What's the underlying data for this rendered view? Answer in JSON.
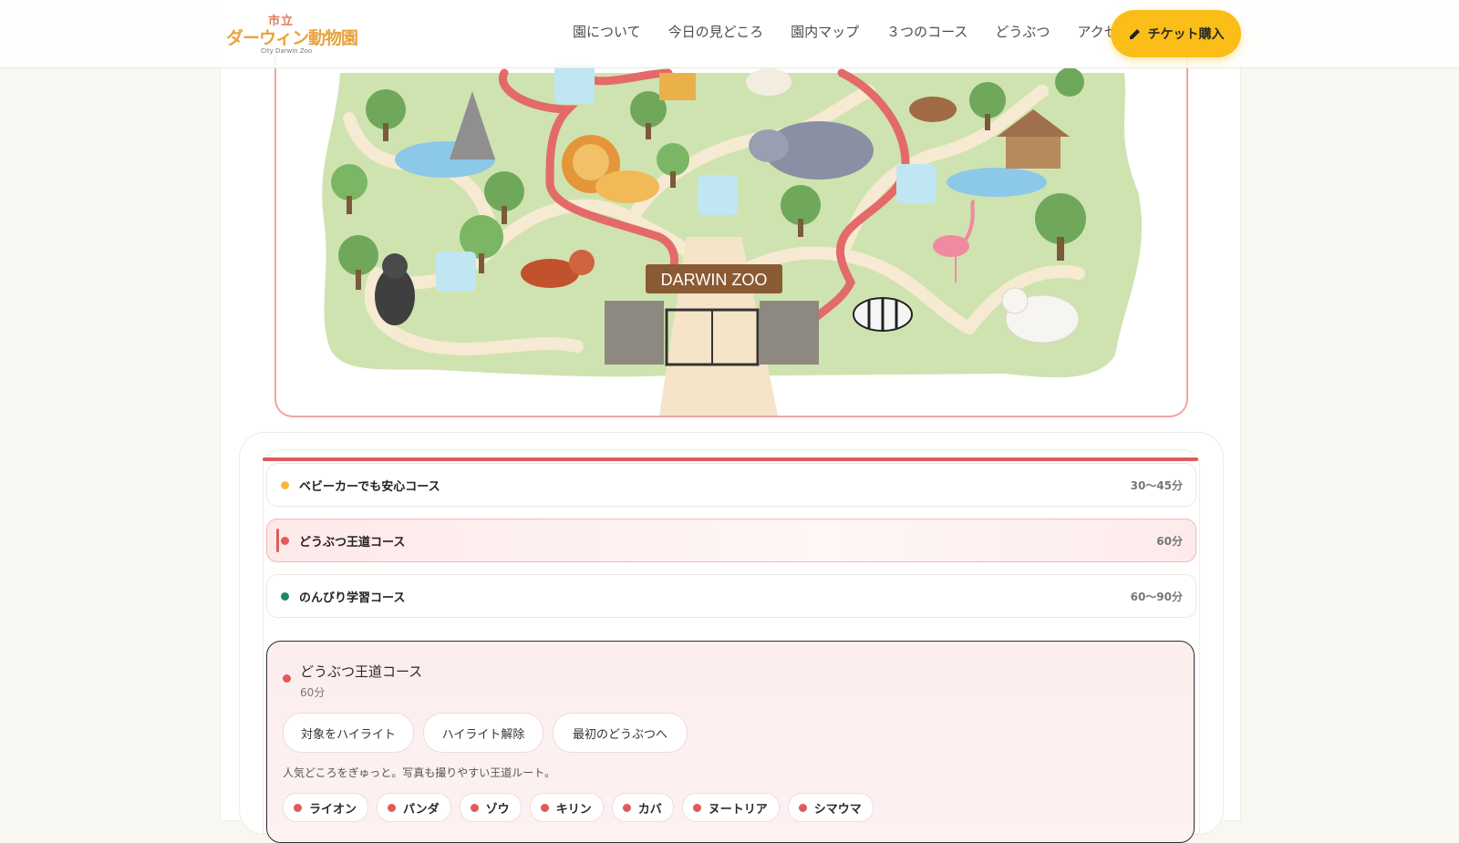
{
  "header": {
    "logo": {
      "top": "市立",
      "main": "ダーウィン動物園",
      "sub": "City Darwin Zoo"
    },
    "nav": [
      "園について",
      "今日の見どころ",
      "園内マップ",
      "３つのコース",
      "どうぶつ",
      "アクセス"
    ],
    "ticket_label": "チケット購入"
  },
  "map": {
    "sign": "DARWIN ZOO"
  },
  "courses": [
    {
      "name": "ベビーカーでも安心コース",
      "time": "30〜45分",
      "color": "#f6b93b",
      "active": false
    },
    {
      "name": "どうぶつ王道コース",
      "time": "60分",
      "color": "#e05a5a",
      "active": true
    },
    {
      "name": "のんびり学習コース",
      "time": "60〜90分",
      "color": "#1e8a5e",
      "active": false
    }
  ],
  "detail": {
    "title": "どうぶつ王道コース",
    "time": "60分",
    "buttons": [
      "対象をハイライト",
      "ハイライト解除",
      "最初のどうぶつへ"
    ],
    "description": "人気どころをぎゅっと。写真も撮りやすい王道ルート。",
    "animals": [
      "ライオン",
      "パンダ",
      "ゾウ",
      "キリン",
      "カバ",
      "ヌートリア",
      "シマウマ"
    ]
  },
  "colors": {
    "accent": "#e05a5a",
    "ticket": "#fbbd18",
    "map_green": "#cfe3b0",
    "path": "#f6e6c8"
  }
}
